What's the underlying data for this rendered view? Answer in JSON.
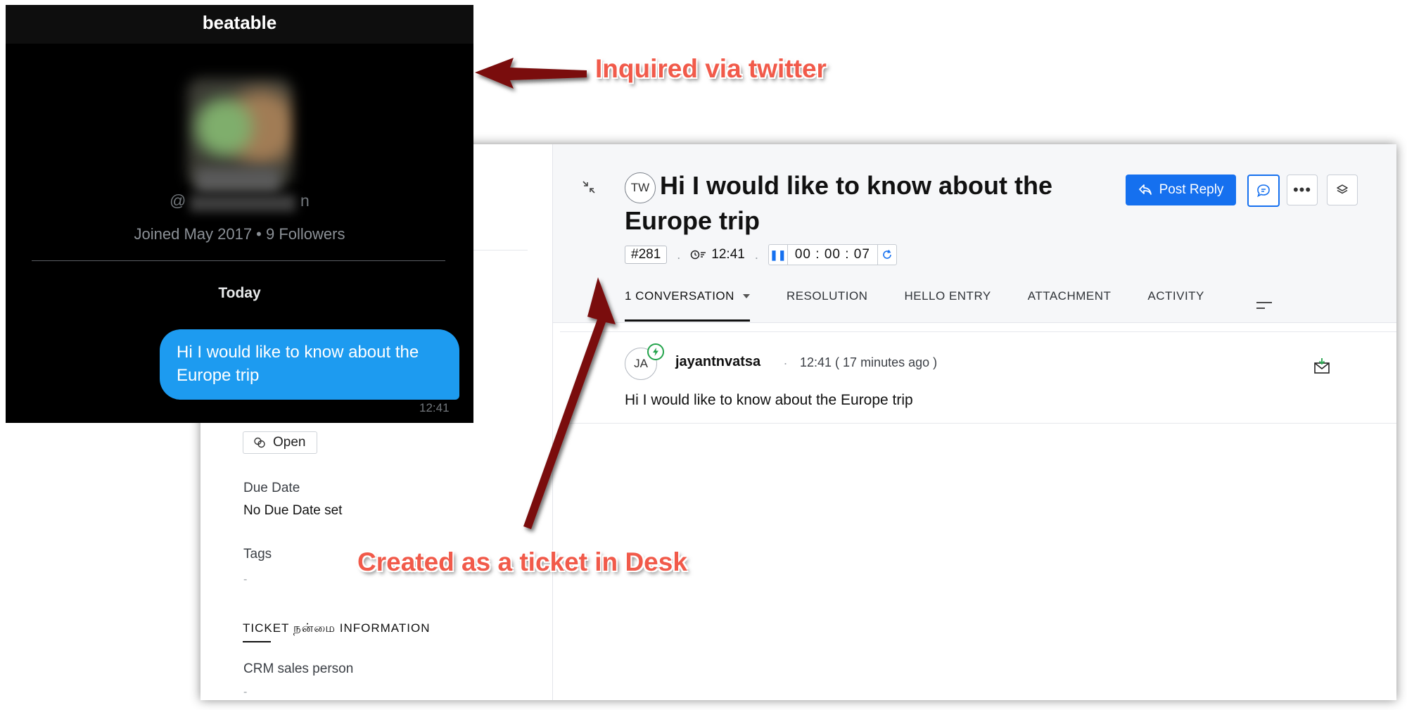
{
  "twitter": {
    "display_name": "beatable",
    "handle_prefix": "@",
    "handle_suffix": "n",
    "joined": "Joined May 2017 • 9 Followers",
    "day_label": "Today",
    "message": "Hi I would like to know about the Europe trip",
    "message_time": "12:41"
  },
  "desk": {
    "channel_badge": "TW",
    "ticket_title": "Hi I would like to know about the Europe trip",
    "ticket_id": "#281",
    "created_time": "12:41",
    "timer_value": "00 : 00 : 07",
    "post_reply_label": "Post Reply",
    "tabs": [
      {
        "label": "1 CONVERSATION"
      },
      {
        "label": "RESOLUTION"
      },
      {
        "label": "HELLO ENTRY"
      },
      {
        "label": "ATTACHMENT"
      },
      {
        "label": "ACTIVITY"
      }
    ],
    "conversation": {
      "avatar_initials": "JA",
      "author": "jayantnvatsa",
      "time": "12:41 ( 17 minutes ago )",
      "body": "Hi I would like to know about the Europe trip"
    },
    "left_panel": {
      "status": "Open",
      "due_date_label": "Due Date",
      "due_date_value": "No Due Date set",
      "tags_label": "Tags",
      "tags_value": "-",
      "section_title": "TICKET நன்மை INFORMATION",
      "crm_label": "CRM sales person",
      "crm_value": "-"
    }
  },
  "annotations": {
    "twitter_note": "Inquired via twitter",
    "desk_note": "Created as a ticket in Desk",
    "color": "#f15a4a",
    "arrow_color": "#7a1010"
  },
  "colors": {
    "primary": "#1570ef",
    "tweet_bubble": "#1d9bf0"
  }
}
